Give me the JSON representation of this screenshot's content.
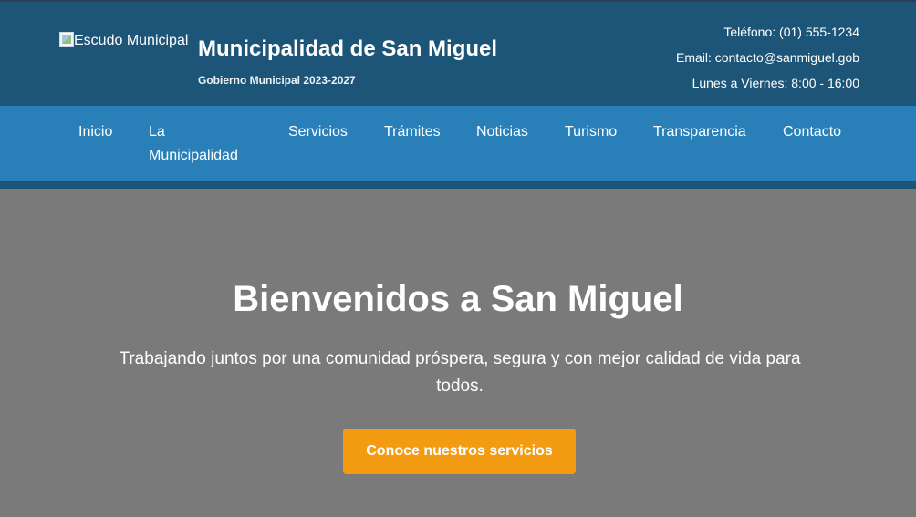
{
  "header": {
    "logo_alt": "Escudo Municipal",
    "title": "Municipalidad de San Miguel",
    "subtitle": "Gobierno Municipal 2023-2027",
    "contact": {
      "phone": "Teléfono: (01) 555-1234",
      "email": "Email: contacto@sanmiguel.gob",
      "hours": "Lunes a Viernes: 8:00 - 16:00"
    }
  },
  "nav": {
    "items": [
      {
        "label": "Inicio"
      },
      {
        "label": "La"
      },
      {
        "label": "Municipalidad"
      },
      {
        "label": "Servicios"
      },
      {
        "label": "Trámites"
      },
      {
        "label": "Noticias"
      },
      {
        "label": "Turismo"
      },
      {
        "label": "Transparencia"
      },
      {
        "label": "Contacto"
      }
    ]
  },
  "hero": {
    "title": "Bienvenidos a San Miguel",
    "text": "Trabajando juntos por una comunidad próspera, segura y con mejor calidad de vida para todos.",
    "button_label": "Conoce nuestros servicios"
  },
  "colors": {
    "header_bg": "#1d5578",
    "nav_bg": "#2980b9",
    "hero_bg": "#7a7a7a",
    "accent": "#f39c12"
  }
}
